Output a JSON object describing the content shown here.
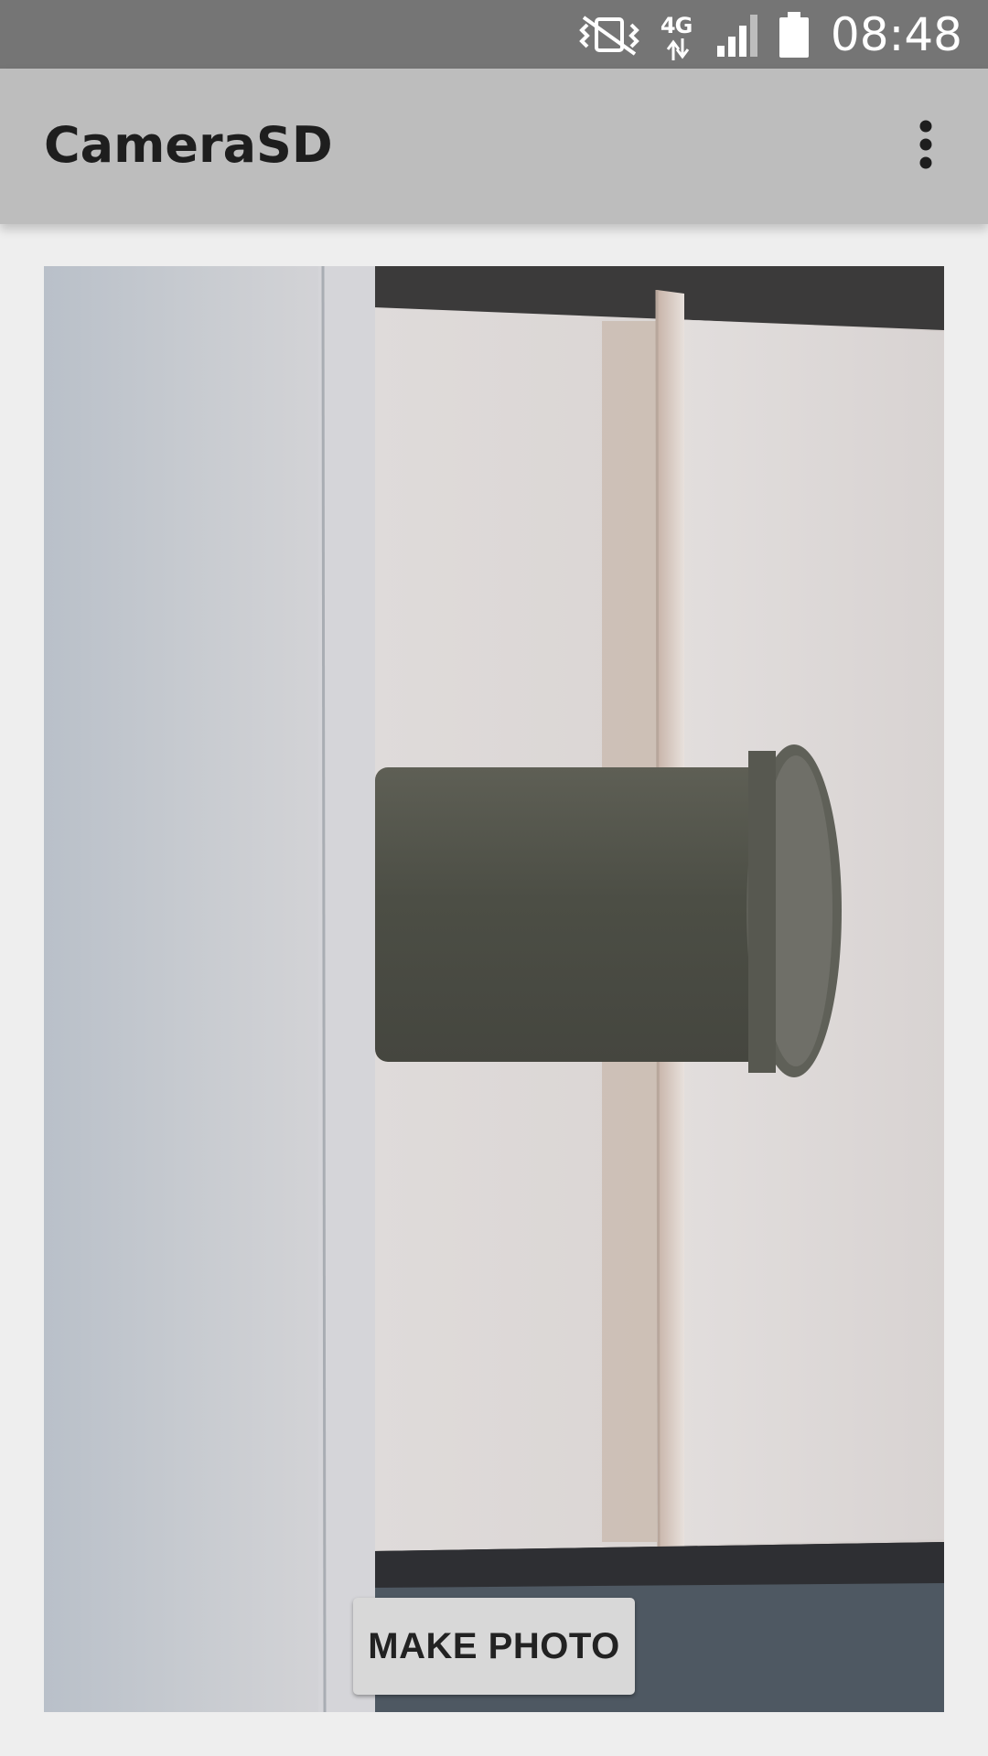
{
  "status_bar": {
    "network_type": "4G",
    "time": "08:48",
    "icons": [
      "vibrate-mute-icon",
      "data-arrows-icon",
      "signal-icon",
      "battery-icon"
    ]
  },
  "app_bar": {
    "title": "CameraSD",
    "menu_icon": "more-vert-icon"
  },
  "camera": {
    "capture_button_label": "MAKE PHOTO"
  },
  "colors": {
    "status_bar_bg": "#757575",
    "app_bar_bg": "#bdbdbd",
    "page_bg": "#eeeeee",
    "button_bg": "#d8d8d8"
  }
}
